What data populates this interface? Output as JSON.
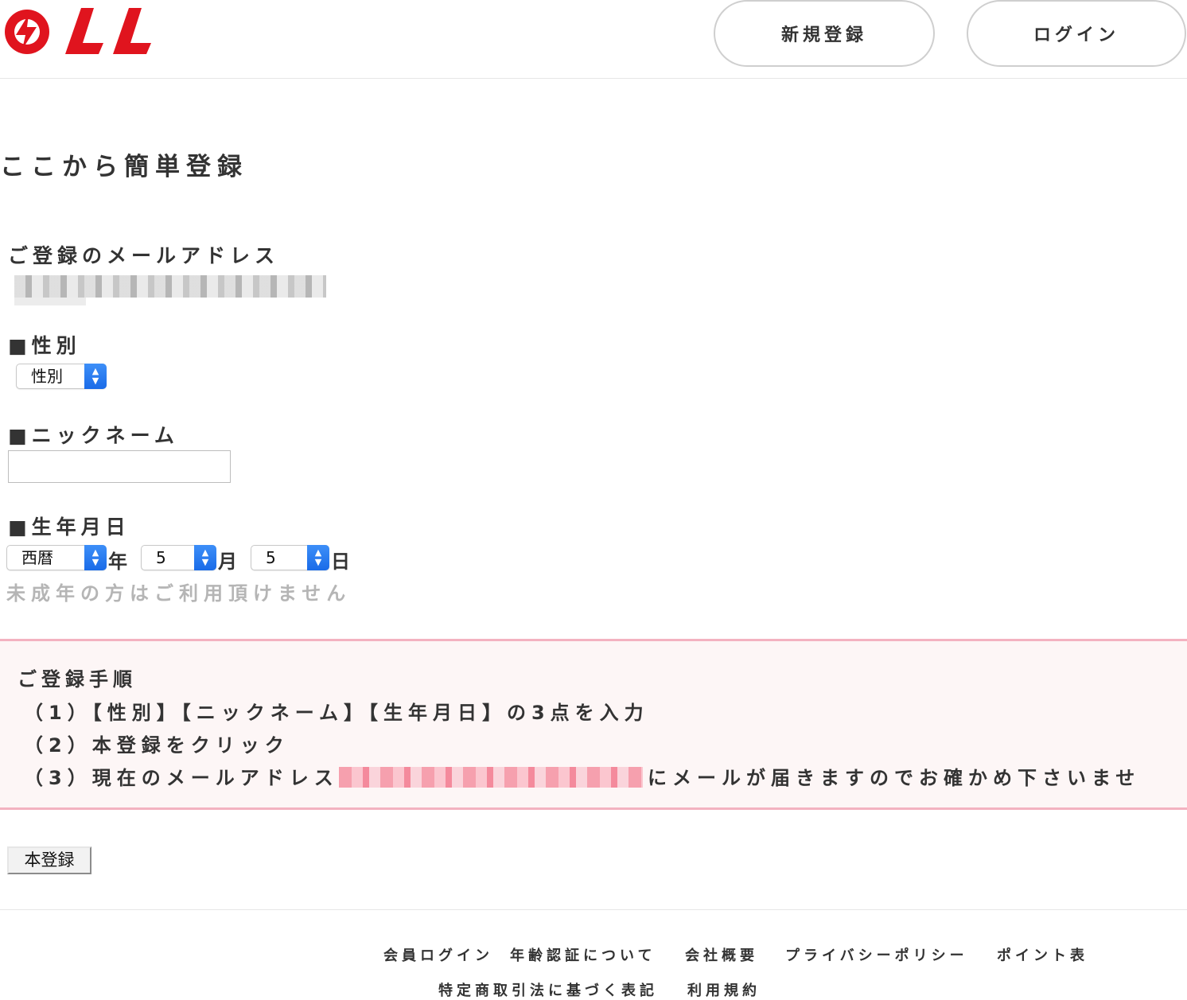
{
  "header": {
    "register_label": "新規登録",
    "login_label": "ログイン"
  },
  "page_title": "ここから簡単登録",
  "email_section": {
    "label": "ご登録のメールアドレス"
  },
  "gender": {
    "label": "■性別",
    "selected": "性別"
  },
  "nickname": {
    "label": "■ニックネーム",
    "value": ""
  },
  "birthday": {
    "label": "■生年月日",
    "year_selected": "西暦",
    "year_unit": "年",
    "month_selected": "5",
    "month_unit": "月",
    "day_selected": "5",
    "day_unit": "日",
    "note": "未成年の方はご利用頂けません"
  },
  "steps": {
    "title": "ご登録手順",
    "step1": "（1）【性別】【ニックネーム】【生年月日】の3点を入力",
    "step2": "（2）本登録をクリック",
    "step3_prefix": "（3）現在のメールアドレス",
    "step3_suffix": "にメールが届きますのでお確かめ下さいませ"
  },
  "submit_label": "本登録",
  "footer": {
    "links_row1": [
      "会員ログイン",
      "年齢認証について",
      "会社概要",
      "プライバシーポリシー",
      "ポイント表"
    ],
    "links_row2": [
      "特定商取引法に基づく表記",
      "利用規約"
    ]
  },
  "colors": {
    "brand_red": "#e0141e",
    "steps_border": "#f3b2c0",
    "steps_bg": "#fdf6f6",
    "select_arrow_blue": "#2c7cf0"
  }
}
